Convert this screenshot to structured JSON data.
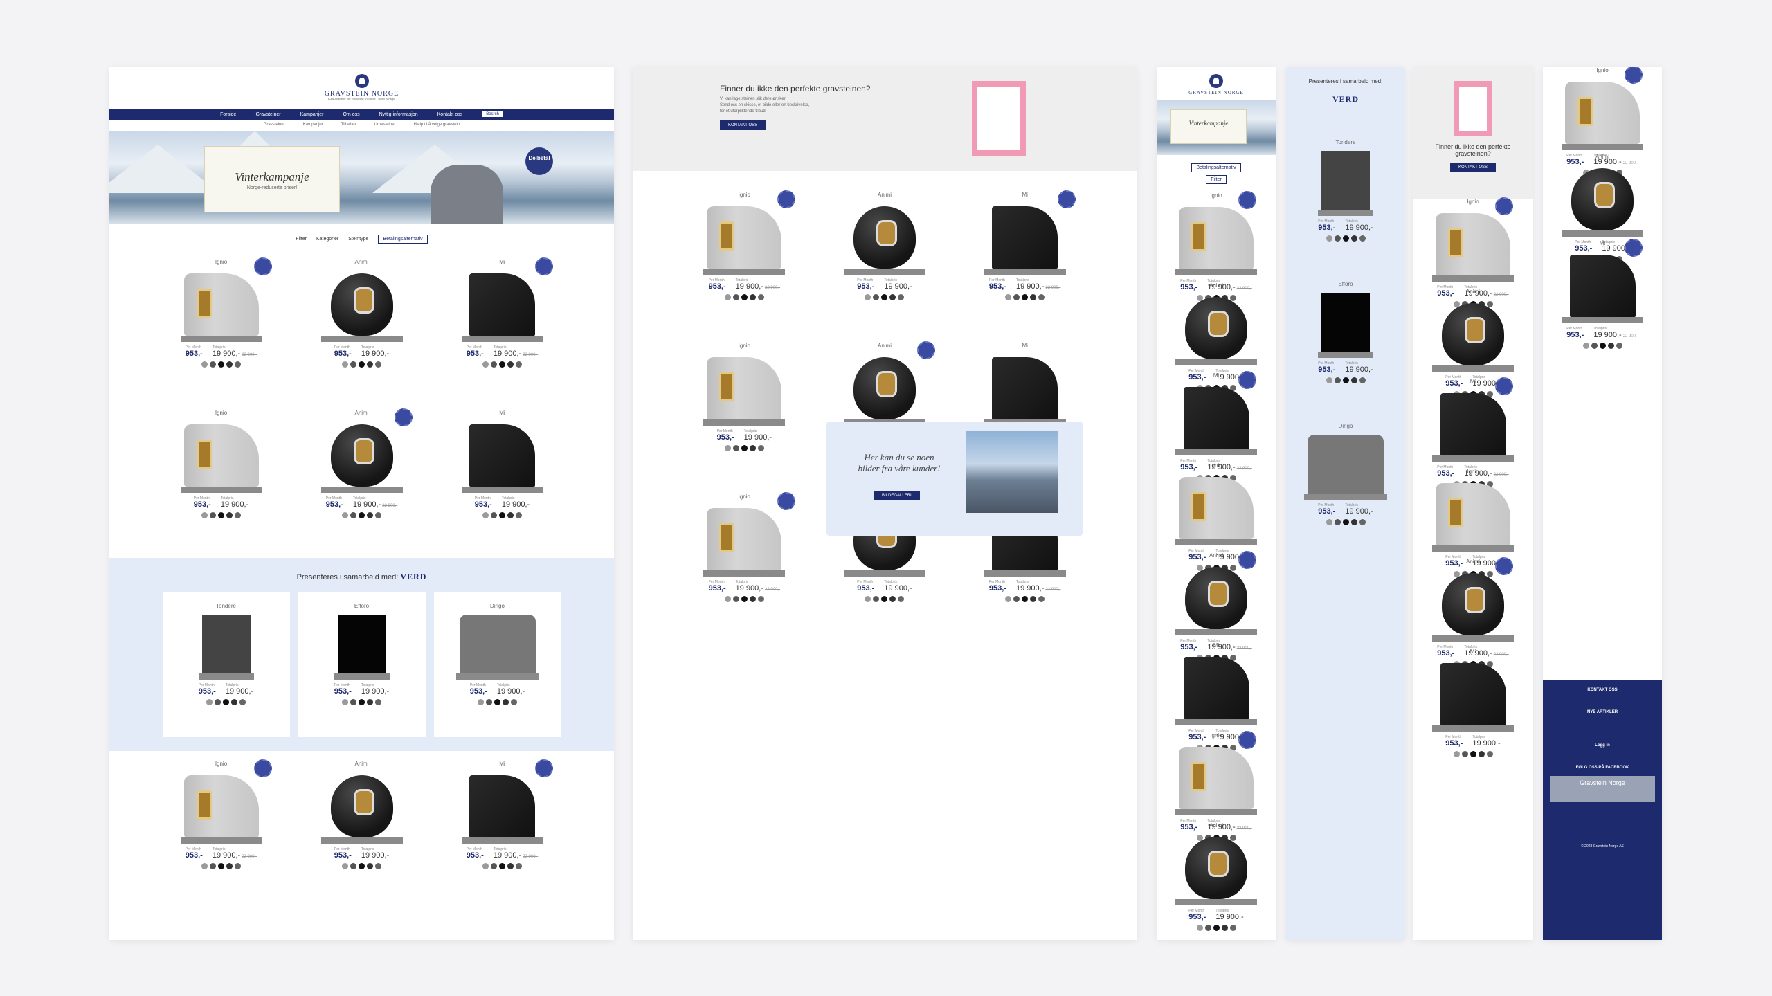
{
  "brand": {
    "title": "GRAVSTEIN NORGE",
    "subtitle": "Gravsteiner av høyeste kvalitet i hele Norge"
  },
  "nav": {
    "items": [
      "Forside",
      "Gravsteiner",
      "Kampanjer",
      "Om oss",
      "Nyttig informasjon",
      "Kontakt oss"
    ],
    "search": "Besrch"
  },
  "subnav": [
    "Gravsteiner",
    "Kampanjer",
    "Tilbehør",
    "Urnesteiner",
    "Hjelp til å velge gravstein"
  ],
  "hero": {
    "title": "Vinterkampanje",
    "subtitle": "Norge-reduserte priser!",
    "badge": "Delbetal"
  },
  "filters": {
    "filter": "Filter",
    "category": "Kategorier",
    "type": "Steintype",
    "payment": "Betalingsalternativ"
  },
  "labels": {
    "per_month": "Per Month",
    "regular": "Totalpris"
  },
  "products": [
    {
      "name": "Ignio",
      "monthly": "953,-",
      "price": "19 900,-",
      "old": "22 900,-",
      "type": "ignio"
    },
    {
      "name": "Animi",
      "monthly": "953,-",
      "price": "19 900,-",
      "old": "",
      "type": "animi"
    },
    {
      "name": "Mi",
      "monthly": "953,-",
      "price": "19 900,-",
      "old": "22 900,-",
      "type": "mi"
    },
    {
      "name": "Ignio",
      "monthly": "953,-",
      "price": "19 900,-",
      "old": "",
      "type": "ignio"
    },
    {
      "name": "Animi",
      "monthly": "953,-",
      "price": "19 900,-",
      "old": "22 900,-",
      "type": "animi"
    },
    {
      "name": "Mi",
      "monthly": "953,-",
      "price": "19 900,-",
      "old": "",
      "type": "mi"
    }
  ],
  "partner": {
    "heading": "Presenteres i samarbeid med:",
    "brand": "VERD",
    "items": [
      {
        "name": "Tondere",
        "monthly": "953,-",
        "price": "19 900,-"
      },
      {
        "name": "Efforo",
        "monthly": "953,-",
        "price": "19 900,-"
      },
      {
        "name": "Dirigo",
        "monthly": "953,-",
        "price": "19 900,-"
      }
    ]
  },
  "promo": {
    "title": "Finner du ikke den perfekte gravsteinen?",
    "text1": "Vi kan lage steinen slik dere ønsker!",
    "text2": "Send oss en skisse, et bilde eller en beskrivelse,",
    "text3": "for et uforpliktende tilbud.",
    "button": "KONTAKT OSS"
  },
  "gallery": {
    "quote": "Her kan du se noen bilder fra våre kunder!",
    "button": "BILDEGALLERI"
  },
  "footer": {
    "contact": "KONTAKT OSS",
    "articles": "NYE ARTIKLER",
    "login": "Logg in",
    "facebook": "FØLG OSS PÅ FACEBOOK",
    "fb_page": "Gravstein Norge",
    "copyright": "© 2023 Gravstein Norge AS"
  },
  "dot_colors": [
    "#9a9a9a",
    "#555555",
    "#111111",
    "#333333",
    "#666666"
  ]
}
